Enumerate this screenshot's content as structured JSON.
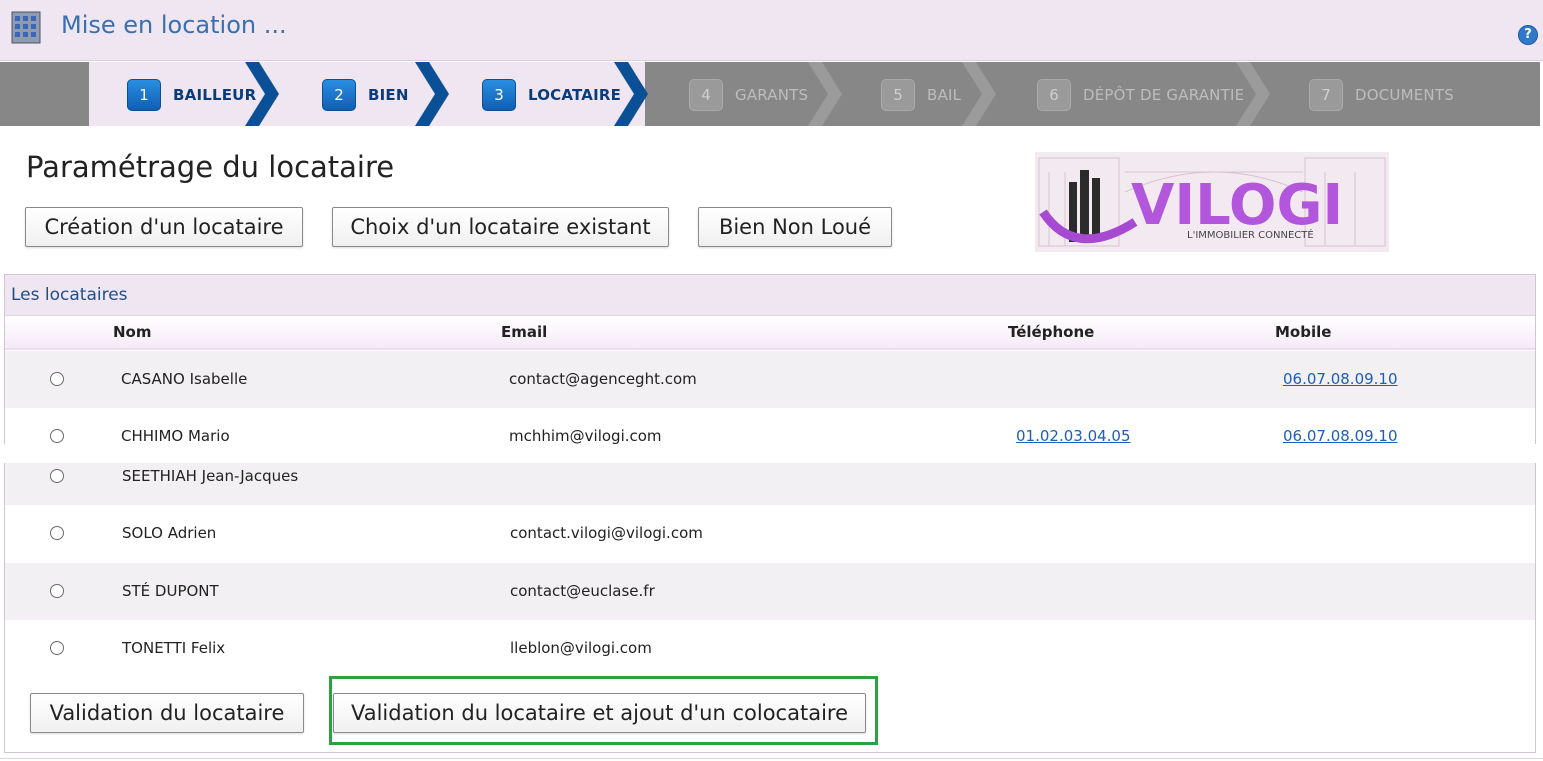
{
  "header": {
    "title": "Mise en location ...",
    "app_icon": "building-icon",
    "help_icon": "help-icon"
  },
  "wizard": {
    "steps": [
      {
        "num": "1",
        "label": "BAILLEUR",
        "state": "active"
      },
      {
        "num": "2",
        "label": "BIEN",
        "state": "active"
      },
      {
        "num": "3",
        "label": "LOCATAIRE",
        "state": "active"
      },
      {
        "num": "4",
        "label": "GARANTS",
        "state": "inactive"
      },
      {
        "num": "5",
        "label": "BAIL",
        "state": "inactive"
      },
      {
        "num": "6",
        "label": "DÉPÔT DE GARANTIE",
        "state": "inactive"
      },
      {
        "num": "7",
        "label": "DOCUMENTS",
        "state": "inactive"
      }
    ]
  },
  "page": {
    "title": "Paramétrage du locataire",
    "buttons": {
      "create": "Création d'un locataire",
      "choose": "Choix d'un locataire existant",
      "not_rented": "Bien Non Loué"
    }
  },
  "logo": {
    "text": "VILOGI",
    "tagline": "L'IMMOBILIER CONNECTÉ"
  },
  "table": {
    "title": "Les locataires",
    "columns": {
      "name": "Nom",
      "email": "Email",
      "phone": "Téléphone",
      "mobile": "Mobile"
    },
    "rows": [
      {
        "name": "CASANO Isabelle",
        "email": "contact@agenceght.com",
        "phone": "",
        "mobile": "06.07.08.09.10"
      },
      {
        "name": "CHHIMO Mario",
        "email": "mchhim@vilogi.com",
        "phone": "01.02.03.04.05",
        "mobile": "06.07.08.09.10"
      },
      {
        "name": "SEETHIAH Jean-Jacques",
        "email": "",
        "phone": "",
        "mobile": ""
      },
      {
        "name": "SOLO Adrien",
        "email": "contact.vilogi@vilogi.com",
        "phone": "",
        "mobile": ""
      },
      {
        "name": "STÉ DUPONT",
        "email": "contact@euclase.fr",
        "phone": "",
        "mobile": ""
      },
      {
        "name": "TONETTI Felix",
        "email": "lleblon@vilogi.com",
        "phone": "",
        "mobile": ""
      }
    ]
  },
  "actions": {
    "validate": "Validation du locataire",
    "validate_add": "Validation du locataire et ajout d'un colocataire"
  },
  "colors": {
    "header_bg": "#efe6f1",
    "title_blue": "#3a6fb0",
    "step_active": "#0f5fb3",
    "wizard_gray": "#878787",
    "link_blue": "#1b5fb8",
    "highlight_green": "#2ea043"
  }
}
